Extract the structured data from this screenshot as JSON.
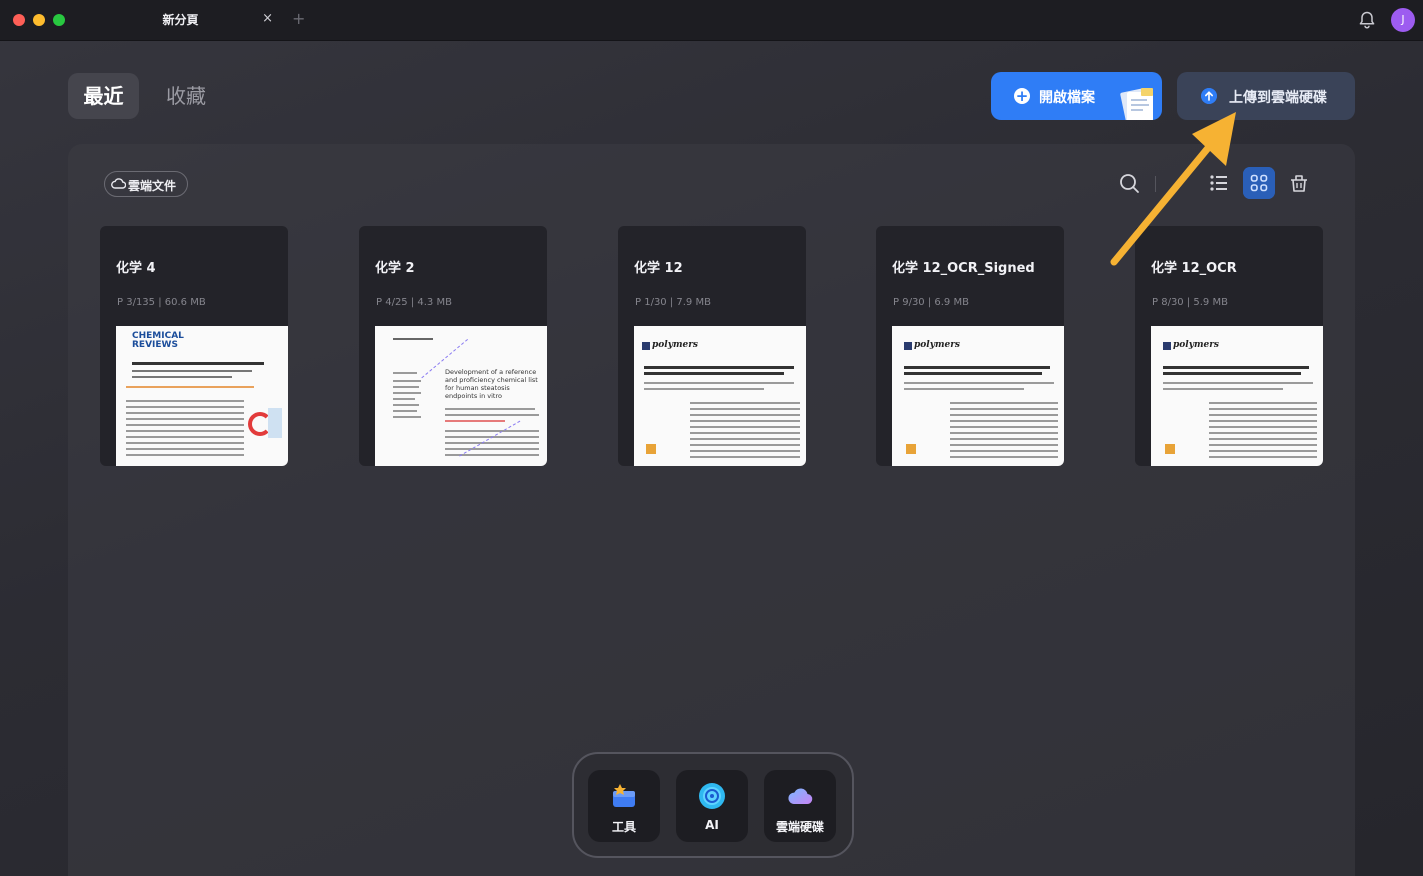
{
  "titlebar": {
    "tab_title": "新分頁",
    "tab_close": "×",
    "tab_add": "+",
    "avatar_letter": "J"
  },
  "nav": {
    "recent": "最近",
    "favorites": "收藏"
  },
  "actions": {
    "open_file": "開啟檔案",
    "upload_cloud": "上傳到雲端硬碟"
  },
  "toolbar": {
    "cloud_docs": "雲端文件",
    "icons": [
      "search-icon",
      "list-view-icon",
      "grid-view-icon",
      "trash-icon"
    ],
    "active_view": "grid"
  },
  "files": [
    {
      "name": "化学 4",
      "meta": "P 3/135 | 60.6 MB",
      "thumb": "chemical-reviews"
    },
    {
      "name": "化学 2",
      "meta": "P 4/25 | 4.3 MB",
      "thumb": "annotated"
    },
    {
      "name": "化学 12",
      "meta": "P 1/30 | 7.9 MB",
      "thumb": "polymers"
    },
    {
      "name": "化学 12_OCR_Signed",
      "meta": "P 9/30 | 6.9 MB",
      "thumb": "polymers"
    },
    {
      "name": "化学 12_OCR",
      "meta": "P 8/30 | 5.9 MB",
      "thumb": "polymers"
    }
  ],
  "thumb_text": {
    "chem_title": "CHEMICAL REVIEWS",
    "polymers": "polymers",
    "doc2_heading": "Development of a reference and proficiency chemical list for human steatosis endpoints in vitro"
  },
  "dock": {
    "tools": "工具",
    "ai": "AI",
    "cloud": "雲端硬碟"
  },
  "colors": {
    "accent": "#2f7df6",
    "arrow": "#f6b233",
    "avatar": "#9d5cf0"
  }
}
